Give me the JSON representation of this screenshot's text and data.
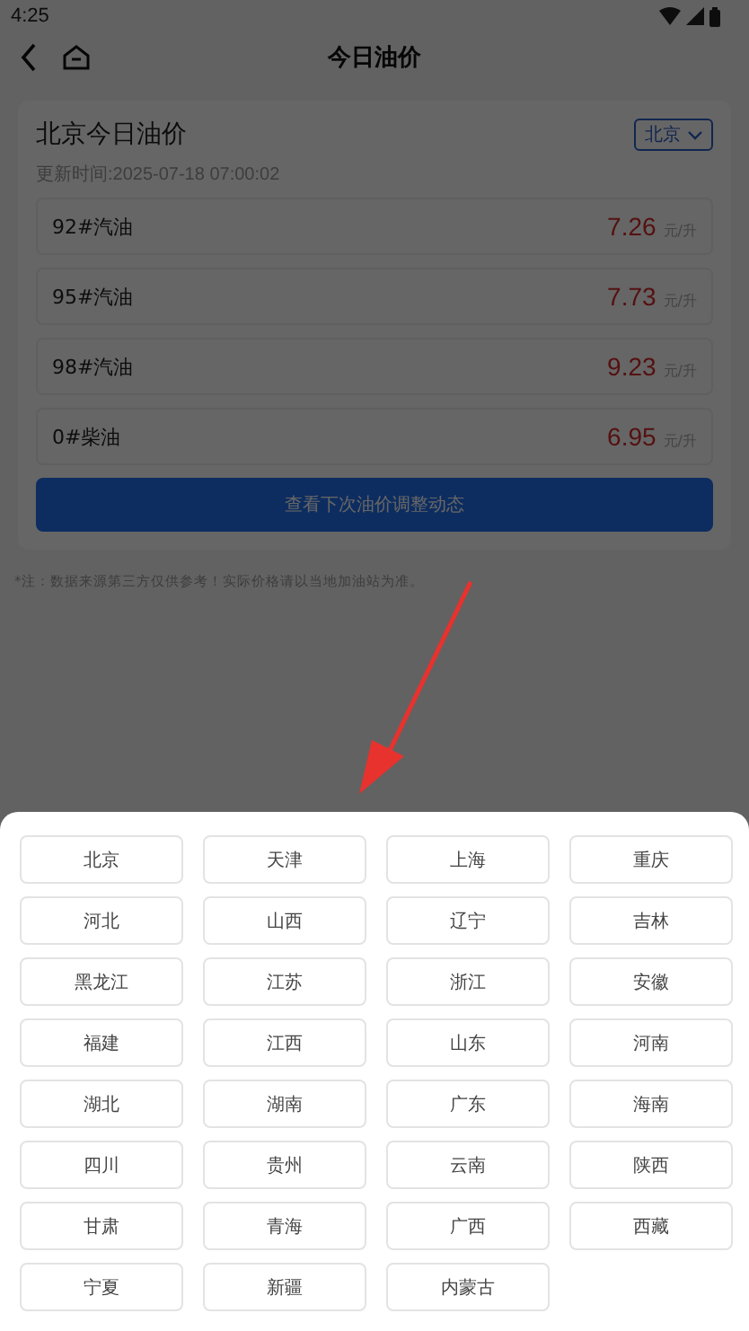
{
  "status_bar": {
    "time": "4:25"
  },
  "header": {
    "title": "今日油价"
  },
  "card": {
    "title": "北京今日油价",
    "city_select": "北京",
    "updated": "更新时间:2025-07-18 07:00:02",
    "prices": [
      {
        "name": "92#汽油",
        "price": "7.26",
        "unit": "元/升"
      },
      {
        "name": "95#汽油",
        "price": "7.73",
        "unit": "元/升"
      },
      {
        "name": "98#汽油",
        "price": "9.23",
        "unit": "元/升"
      },
      {
        "name": "0#柴油",
        "price": "6.95",
        "unit": "元/升"
      }
    ],
    "button": "查看下次油价调整动态"
  },
  "note": "*注：数据来源第三方仅供参考！实际价格请以当地加油站为准。",
  "overlay": {
    "dimmed": true
  },
  "province_sheet": {
    "provinces": [
      "北京",
      "天津",
      "上海",
      "重庆",
      "河北",
      "山西",
      "辽宁",
      "吉林",
      "黑龙江",
      "江苏",
      "浙江",
      "安徽",
      "福建",
      "江西",
      "山东",
      "河南",
      "湖北",
      "湖南",
      "广东",
      "海南",
      "四川",
      "贵州",
      "云南",
      "陕西",
      "甘肃",
      "青海",
      "广西",
      "西藏",
      "宁夏",
      "新疆",
      "内蒙古"
    ]
  }
}
